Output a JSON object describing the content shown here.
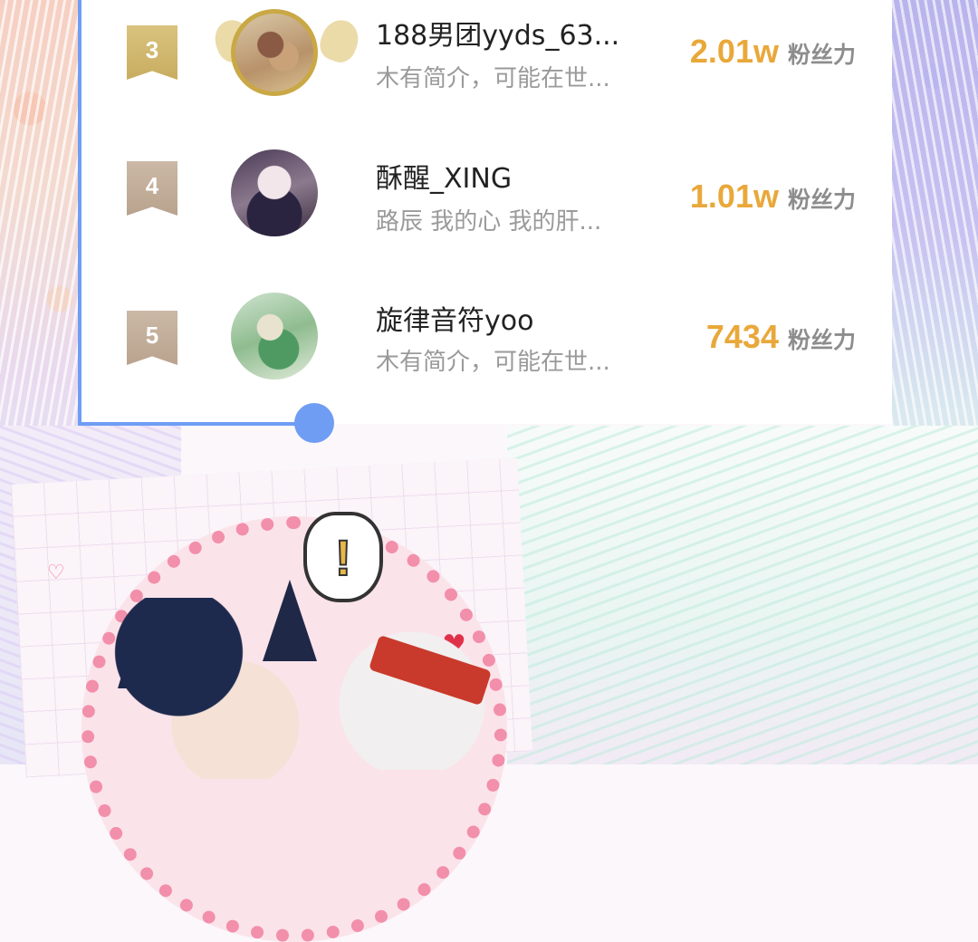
{
  "ranking": {
    "items": [
      {
        "rank": "3",
        "name": "188男团yyds_63...",
        "intro": "木有简介，可能在世...",
        "score": "2.01w",
        "score_label": "粉丝力"
      },
      {
        "rank": "4",
        "name": "酥醒_XING",
        "intro": "路辰  我的心  我的肝...",
        "score": "1.01w",
        "score_label": "粉丝力"
      },
      {
        "rank": "5",
        "name": "旋律音符yoo",
        "intro": "木有简介，可能在世...",
        "score": "7434",
        "score_label": "粉丝力"
      }
    ]
  },
  "illustration": {
    "exclamation": "!"
  },
  "colors": {
    "accent_blue": "#6f9df4",
    "score_gold": "#e9a83a",
    "rank_gold": "#c8ad60",
    "rank_tan": "#b9a38e"
  }
}
